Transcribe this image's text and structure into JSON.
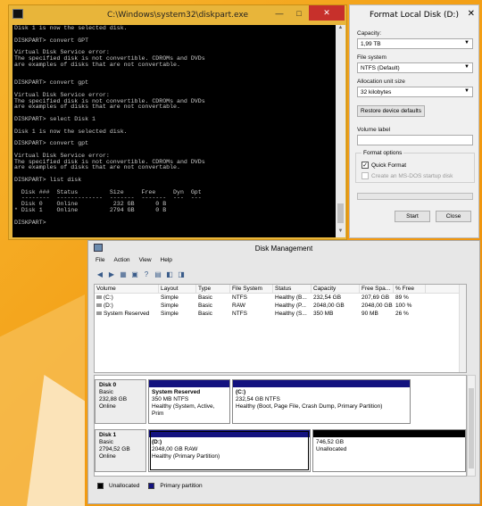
{
  "colors": {
    "desktop": "#f4a316",
    "console_bg": "#000000",
    "console_fg": "#c8c8c8",
    "primary_partition": "#13127f",
    "unallocated": "#000000",
    "close_button": "#c7302b"
  },
  "cmd": {
    "title": "C:\\Windows\\system32\\diskpart.exe",
    "minimize": "—",
    "maximize": "□",
    "close": "✕",
    "console_text": "Disk 1 is now the selected disk.\n\nDISKPART> convert GPT\n\nVirtual Disk Service error:\nThe specified disk is not convertible. CDROMs and DVDs\nare examples of disks that are not convertable.\n\n\nDISKPART> convert gpt\n\nVirtual Disk Service error:\nThe specified disk is not convertible. CDROMs and DVDs\nare examples of disks that are not convertable.\n\nDISKPART> select Disk 1\n\nDisk 1 is now the selected disk.\n\nDISKPART> convert gpt\n\nVirtual Disk Service error:\nThe specified disk is not convertible. CDROMs and DVDs\nare examples of disks that are not convertable.\n\nDISKPART> list disk\n\n  Disk ###  Status         Size     Free     Dyn  Gpt\n  --------  -------------  -------  -------  ---  ---\n  Disk 0    Online          232 GB      0 B\n* Disk 1    Online         2794 GB      0 B\n\nDISKPART> "
  },
  "format": {
    "title": "Format Local Disk (D:)",
    "close": "✕",
    "capacity_label": "Capacity:",
    "capacity_value": "1,99 TB",
    "filesystem_label": "File system",
    "filesystem_value": "NTFS (Default)",
    "allocation_label": "Allocation unit size",
    "allocation_value": "32 kilobytes",
    "restore_button": "Restore device defaults",
    "volume_label": "Volume label",
    "volume_value": "",
    "options_label": "Format options",
    "quick_format": "Quick Format",
    "quick_format_checked": true,
    "msdos_disk": "Create an MS-DOS startup disk",
    "progress": 0,
    "start_button": "Start",
    "close_button": "Close"
  },
  "dm": {
    "title": "Disk Management",
    "menu": [
      "File",
      "Action",
      "View",
      "Help"
    ],
    "toolbar_icons": [
      "back-icon",
      "forward-icon",
      "up-icon",
      "properties-icon",
      "help-icon",
      "refresh-icon",
      "connect-icon",
      "rescan-icon"
    ],
    "columns": [
      "Volume",
      "Layout",
      "Type",
      "File System",
      "Status",
      "Capacity",
      "Free Spa...",
      "% Free"
    ],
    "rows": [
      [
        "(C:)",
        "Simple",
        "Basic",
        "NTFS",
        "Healthy (B...",
        "232,54 GB",
        "207,69 GB",
        "89 %"
      ],
      [
        "(D:)",
        "Simple",
        "Basic",
        "RAW",
        "Healthy (P...",
        "2048,00 GB",
        "2048,00 GB",
        "100 %"
      ],
      [
        "System Reserved",
        "Simple",
        "Basic",
        "NTFS",
        "Healthy (S...",
        "350 MB",
        "90 MB",
        "26 %"
      ]
    ],
    "disks": [
      {
        "name": "Disk 0",
        "type": "Basic",
        "size": "232,88 GB",
        "status": "Online",
        "partitions": [
          {
            "name": "System Reserved",
            "detail": "350 MB NTFS",
            "status": "Healthy (System, Active, Prim"
          },
          {
            "name": "(C:)",
            "detail": "232,54 GB NTFS",
            "status": "Healthy (Boot, Page File, Crash Dump, Primary Partition)"
          }
        ]
      },
      {
        "name": "Disk 1",
        "type": "Basic",
        "size": "2794,52 GB",
        "status": "Online",
        "partitions": [
          {
            "name": "(D:)",
            "detail": "2048,00 GB RAW",
            "status": "Healthy (Primary Partition)"
          },
          {
            "name": "",
            "detail": "746,52 GB",
            "status": "Unallocated"
          }
        ]
      }
    ],
    "legend": [
      "Unallocated",
      "Primary partition"
    ]
  }
}
